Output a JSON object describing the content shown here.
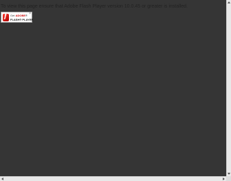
{
  "page": {
    "background": "#353535",
    "notice_text": "To view this page ensure that Adobe Flash Player version 10.0.45 or greater is installed."
  },
  "badge": {
    "get_label": "Get",
    "brand_label": "ADOBE",
    "reg_mark": "®",
    "product_label": "FLASH® PLAYER",
    "logo_glyph": "f",
    "close_glyph": "×",
    "logo_icon": "adobe-flash-logo-icon",
    "accent": "#cc0000"
  },
  "scrollbars": {
    "vertical": "vertical-scrollbar",
    "horizontal": "horizontal-scrollbar"
  }
}
